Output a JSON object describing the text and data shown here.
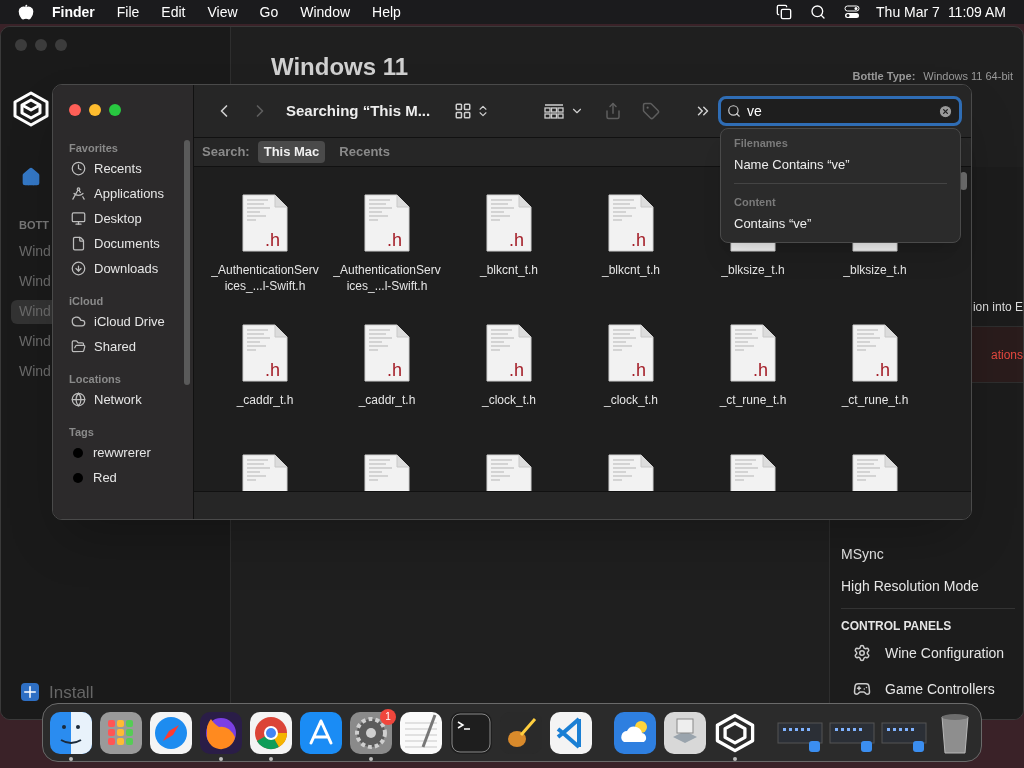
{
  "menu_bar": {
    "app_name": "Finder",
    "menus": [
      "File",
      "Edit",
      "View",
      "Go",
      "Window",
      "Help"
    ],
    "date": "Thu Mar 7",
    "time": "11:09 AM"
  },
  "background_app": {
    "sidebar": {
      "section": "BOTT",
      "bottles": [
        {
          "label": "Wind",
          "selected": false
        },
        {
          "label": "Wind",
          "selected": false
        },
        {
          "label": "Wind",
          "selected": true
        },
        {
          "label": "Wind",
          "selected": false
        },
        {
          "label": "Wind",
          "selected": false
        }
      ],
      "install": "Install"
    },
    "title": "Windows 11",
    "bottle_type_label": "Bottle Type:",
    "bottle_type_value": "Windows 11 64-bit",
    "settings_rows": [
      {
        "label": "ion into E",
        "kind": "plain"
      },
      {
        "label": "ations",
        "kind": "danger"
      }
    ],
    "options": [
      "MSync",
      "High Resolution Mode"
    ],
    "control_panels": {
      "heading": "CONTROL PANELS",
      "items": [
        {
          "label": "Wine Configuration",
          "kind": "gear"
        },
        {
          "label": "Game Controllers",
          "kind": "gamepad"
        }
      ]
    }
  },
  "finder": {
    "title": "Searching “This M...",
    "search": {
      "value": "ve"
    },
    "scope": {
      "label": "Search:",
      "options": [
        {
          "label": "This Mac",
          "selected": true
        },
        {
          "label": "Recents",
          "selected": false
        }
      ]
    },
    "sidebar": [
      {
        "heading": "Favorites",
        "items": [
          {
            "label": "Recents",
            "kind": "clock"
          },
          {
            "label": "Applications",
            "kind": "apps"
          },
          {
            "label": "Desktop",
            "kind": "desktop"
          },
          {
            "label": "Documents",
            "kind": "document"
          },
          {
            "label": "Downloads",
            "kind": "download"
          }
        ]
      },
      {
        "heading": "iCloud",
        "items": [
          {
            "label": "iCloud Drive",
            "kind": "cloud"
          },
          {
            "label": "Shared",
            "kind": "shared"
          }
        ]
      },
      {
        "heading": "Locations",
        "items": [
          {
            "label": "Network",
            "kind": "network"
          }
        ]
      },
      {
        "heading": "Tags",
        "items": [
          {
            "label": "rewwrerer",
            "kind": "tag",
            "color": "#000000"
          },
          {
            "label": "Red",
            "kind": "tag",
            "color": "#000000"
          }
        ]
      }
    ],
    "files": [
      {
        "kind": "full",
        "name": "_AuthenticationServices_...l-Swift.h",
        "badge": ".h"
      },
      {
        "kind": "full",
        "name": "_AuthenticationServices_...l-Swift.h",
        "badge": ".h"
      },
      {
        "kind": "full",
        "name": "_blkcnt_t.h",
        "badge": ".h"
      },
      {
        "kind": "full",
        "name": "_blkcnt_t.h",
        "badge": ".h"
      },
      {
        "kind": "full",
        "name": "_blksize_t.h"
      },
      {
        "kind": "full",
        "name": "_blksize_t.h"
      },
      {
        "kind": "full",
        "name": "_caddr_t.h",
        "badge": ".h"
      },
      {
        "kind": "full",
        "name": "_caddr_t.h",
        "badge": ".h"
      },
      {
        "kind": "full",
        "name": "_clock_t.h",
        "badge": ".h"
      },
      {
        "kind": "full",
        "name": "_clock_t.h",
        "badge": ".h"
      },
      {
        "kind": "full",
        "name": "_ct_rune_t.h",
        "badge": ".h"
      },
      {
        "kind": "full",
        "name": "_ct_rune_t.h",
        "badge": ".h"
      },
      {
        "kind": "partial"
      },
      {
        "kind": "partial"
      },
      {
        "kind": "partial"
      },
      {
        "kind": "partial"
      },
      {
        "kind": "partial"
      },
      {
        "kind": "partial"
      }
    ]
  },
  "search_suggestions": [
    {
      "heading": "Filenames",
      "items": [
        "Name Contains “ve”"
      ]
    },
    {
      "heading": "Content",
      "items": [
        "Contains “ve”"
      ]
    }
  ],
  "dock": [
    {
      "kind": "finder",
      "running": true
    },
    {
      "kind": "launchpad",
      "running": false
    },
    {
      "kind": "compass",
      "running": false
    },
    {
      "kind": "fox",
      "running": true
    },
    {
      "kind": "chrome",
      "running": true
    },
    {
      "kind": "store",
      "running": false
    },
    {
      "kind": "gear",
      "running": true,
      "badge": "1"
    },
    {
      "kind": "notepad",
      "running": false
    },
    {
      "kind": "terminal",
      "running": false
    },
    {
      "kind": "guitar",
      "running": false
    },
    {
      "kind": "code",
      "running": false
    },
    {
      "kind": "separator"
    },
    {
      "kind": "weather",
      "running": false
    },
    {
      "kind": "disk",
      "running": false
    },
    {
      "kind": "logo",
      "running": true
    },
    {
      "kind": "separator"
    },
    {
      "kind": "thumbnail",
      "running": false
    },
    {
      "kind": "thumbnail",
      "running": false
    },
    {
      "kind": "thumbnail",
      "running": false
    },
    {
      "kind": "trash",
      "running": false
    }
  ]
}
